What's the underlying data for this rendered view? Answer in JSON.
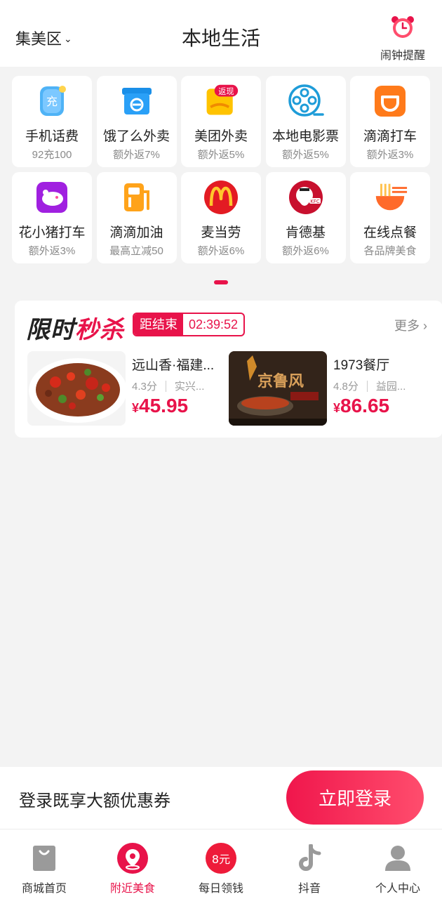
{
  "header": {
    "district": "集美区",
    "title": "本地生活",
    "alarm_label": "闹钟提醒"
  },
  "services": [
    {
      "name": "手机话费",
      "sub": "92充100",
      "icon": "phone-recharge-icon"
    },
    {
      "name": "饿了么外卖",
      "sub": "额外返7%",
      "icon": "eleme-icon"
    },
    {
      "name": "美团外卖",
      "sub": "额外返5%",
      "icon": "meituan-icon",
      "badge": "返现"
    },
    {
      "name": "本地电影票",
      "sub": "额外返5%",
      "icon": "film-reel-icon"
    },
    {
      "name": "滴滴打车",
      "sub": "额外返3%",
      "icon": "didi-icon"
    },
    {
      "name": "花小猪打车",
      "sub": "额外返3%",
      "icon": "huaxiaozhu-icon"
    },
    {
      "name": "滴滴加油",
      "sub": "最高立减50",
      "icon": "fuel-icon"
    },
    {
      "name": "麦当劳",
      "sub": "额外返6%",
      "icon": "mcdonalds-icon"
    },
    {
      "name": "肯德基",
      "sub": "额外返6%",
      "icon": "kfc-icon"
    },
    {
      "name": "在线点餐",
      "sub": "各品牌美食",
      "icon": "noodle-bowl-icon"
    }
  ],
  "flash_sale": {
    "title_a": "限时",
    "title_b": "秒杀",
    "countdown_label": "距结束",
    "countdown_time": "02:39:52",
    "more_label": "更多",
    "deals": [
      {
        "name": "远山香·福建...",
        "rating": "4.3分",
        "location": "实兴...",
        "price_symbol": "¥",
        "price": "45.95"
      },
      {
        "name": "1973餐厅",
        "rating": "4.8分",
        "location": "益园...",
        "price_symbol": "¥",
        "price": "86.65"
      }
    ],
    "deal_image_text": "京鲁风"
  },
  "login": {
    "prompt": "登录既享大额优惠券",
    "button": "立即登录"
  },
  "bottom_nav": [
    {
      "label": "商城首页",
      "icon": "shopping-bag-icon",
      "active": false
    },
    {
      "label": "附近美食",
      "icon": "location-pin-icon",
      "active": true
    },
    {
      "label": "每日领钱",
      "icon": "money-badge-icon",
      "active": false,
      "badge": "8元"
    },
    {
      "label": "抖音",
      "icon": "douyin-icon",
      "active": false
    },
    {
      "label": "个人中心",
      "icon": "user-icon",
      "active": false
    }
  ],
  "colors": {
    "accent": "#e8134a",
    "background": "#f3f3f3"
  }
}
